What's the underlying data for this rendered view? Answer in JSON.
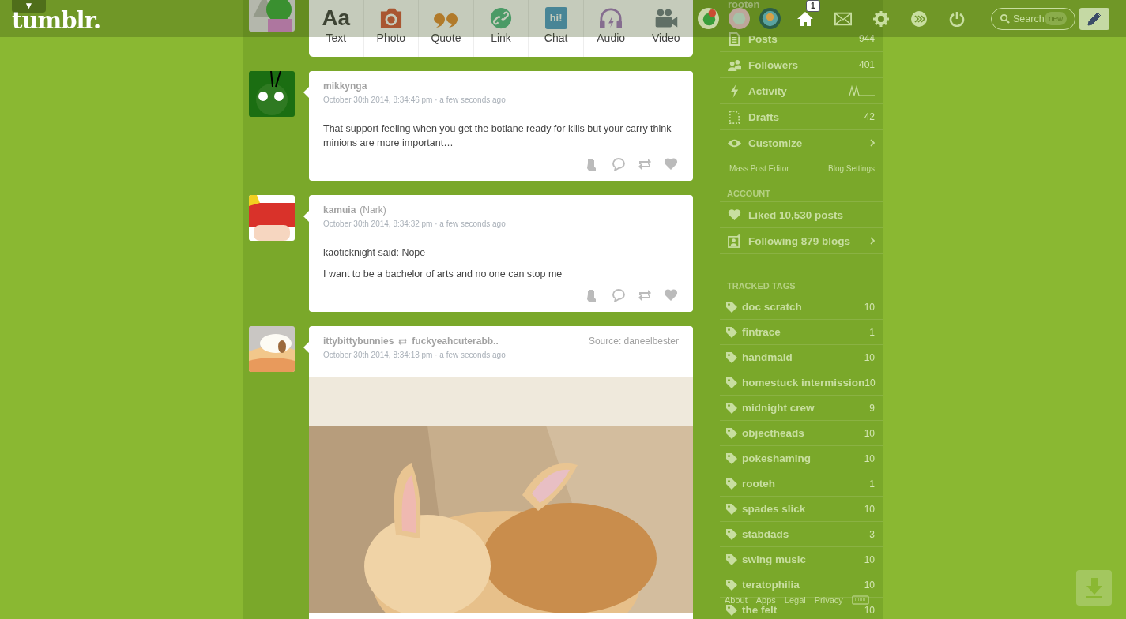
{
  "header": {
    "logo": "tumblr.",
    "menu_toggle": "▼",
    "notifications": "1",
    "search": {
      "placeholder": "Search",
      "badge": "new"
    }
  },
  "post_types": [
    {
      "kind": "text",
      "label": "Text",
      "glyph": "Aa"
    },
    {
      "label": "Photo"
    },
    {
      "kind": "quote",
      "label": "Quote"
    },
    {
      "kind": "link",
      "label": "Link"
    },
    {
      "kind": "chat",
      "label": "Chat",
      "glyph": "hi!"
    },
    {
      "kind": "audio",
      "label": "Audio"
    },
    {
      "kind": "video",
      "label": "Video"
    }
  ],
  "posts": [
    {
      "author": "mikkynga",
      "date": "October 30th 2014, 8:34:46 pm · a few seconds ago",
      "body": [
        "That support feeling when you get the botlane ready for kills but your carry think minions are more important…"
      ]
    },
    {
      "author": "kamuia",
      "alias": "(Nark)",
      "date": "October 30th 2014, 8:34:32 pm · a few seconds ago",
      "quote_from": "kaoticknight",
      "quote_text": "said: Nope",
      "body": [
        "I want to be a bachelor of arts and no one can stop me"
      ]
    },
    {
      "author": "ittybittybunnies",
      "reblog_from": "fuckyeahcuterabb..",
      "source": "Source: daneelbester",
      "date": "October 30th 2014, 8:34:18 pm · a few seconds ago"
    }
  ],
  "sidebar": {
    "blog": {
      "name": "rooten"
    },
    "stats": [
      {
        "kind": "posts",
        "label": "Posts",
        "value": "944"
      },
      {
        "kind": "followers",
        "label": "Followers",
        "value": "401"
      },
      {
        "kind": "activity",
        "label": "Activity"
      },
      {
        "kind": "drafts",
        "label": "Drafts",
        "value": "42"
      },
      {
        "kind": "customize",
        "label": "Customize"
      }
    ],
    "links": [
      "Mass Post Editor",
      "Blog Settings"
    ],
    "account_heading": "ACCOUNT",
    "account": [
      {
        "kind": "liked",
        "label": "Liked 10,530 posts"
      },
      {
        "kind": "following",
        "label": "Following 879 blogs"
      }
    ],
    "tags_heading": "TRACKED TAGS",
    "tags": [
      {
        "name": "doc scratch",
        "count": "10"
      },
      {
        "name": "fintrace",
        "count": "1"
      },
      {
        "name": "handmaid",
        "count": "10"
      },
      {
        "name": "homestuck intermission",
        "count": "10"
      },
      {
        "name": "midnight crew",
        "count": "9"
      },
      {
        "name": "objectheads",
        "count": "10"
      },
      {
        "name": "pokeshaming",
        "count": "10"
      },
      {
        "name": "rooteh",
        "count": "1"
      },
      {
        "name": "spades slick",
        "count": "10"
      },
      {
        "name": "stabdads",
        "count": "3"
      },
      {
        "name": "swing music",
        "count": "10"
      },
      {
        "name": "teratophilia",
        "count": "10"
      },
      {
        "name": "the felt",
        "count": "10"
      }
    ],
    "footer": [
      "About",
      "Apps",
      "Legal",
      "Privacy"
    ]
  }
}
